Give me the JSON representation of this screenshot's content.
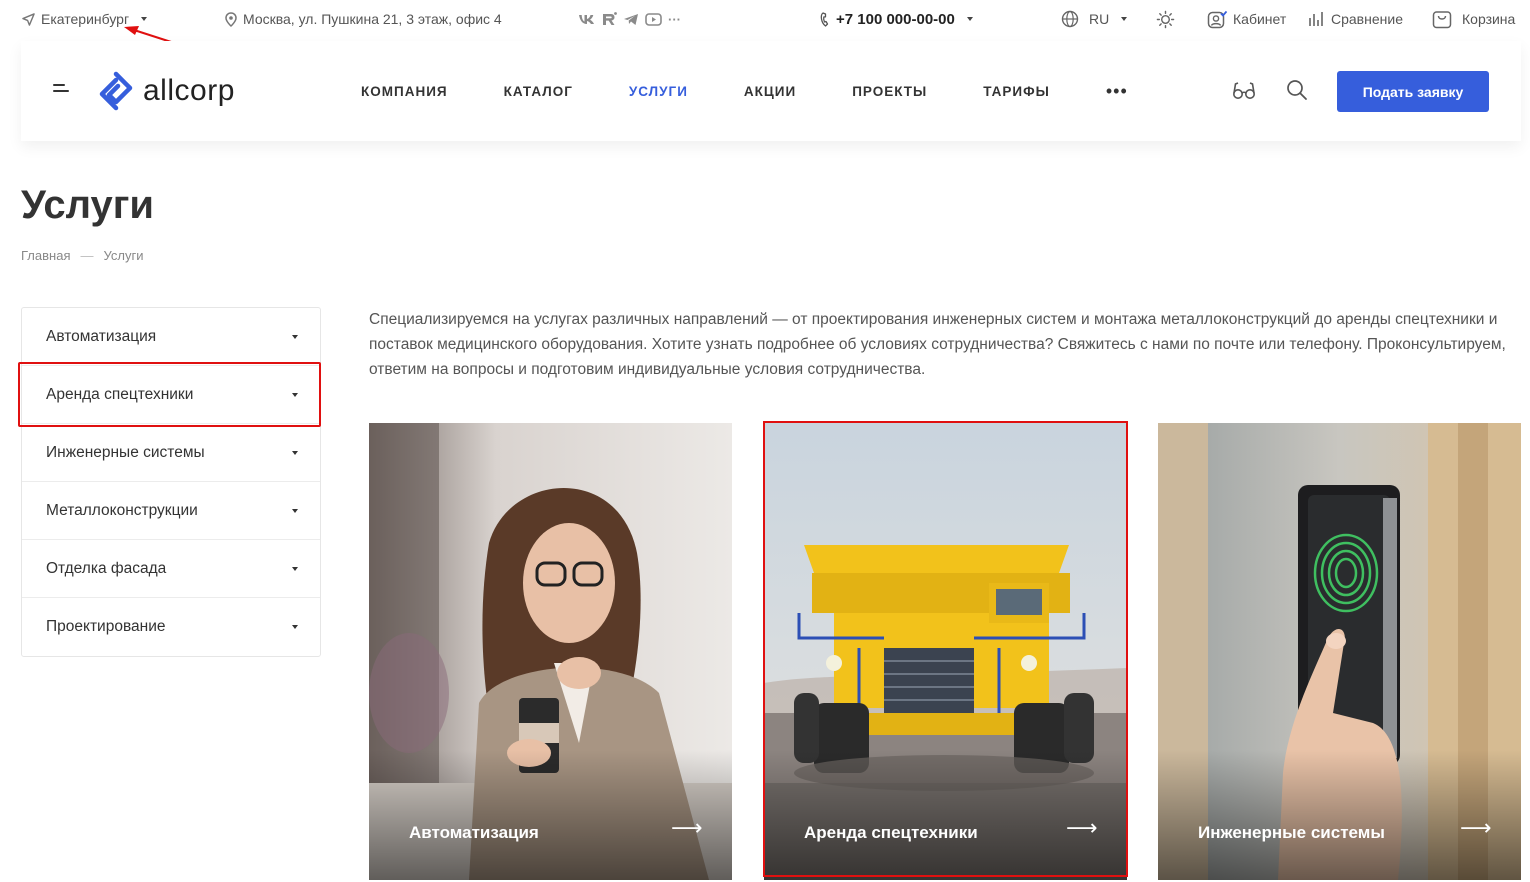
{
  "topbar": {
    "city": "Екатеринбург",
    "address": "Москва, ул. Пушкина 21, 3 этаж, офис 4",
    "socials": [
      "vk-icon",
      "rutube-icon",
      "telegram-icon",
      "youtube-icon",
      "more-icon"
    ],
    "phone": "+7 100 000-00-00",
    "language": "RU",
    "cabinet": "Кабинет",
    "compare": "Сравнение",
    "cart": "Корзина"
  },
  "header": {
    "logo": "allcorp",
    "nav": [
      "КОМПАНИЯ",
      "КАТАЛОГ",
      "УСЛУГИ",
      "АКЦИИ",
      "ПРОЕКТЫ",
      "ТАРИФЫ"
    ],
    "nav_more": "•••",
    "active_nav": "УСЛУГИ",
    "cta": "Подать заявку"
  },
  "page": {
    "title": "Услуги",
    "breadcrumbs": [
      "Главная",
      "Услуги"
    ],
    "breadcrumb_separator": "—",
    "intro": "Специализируемся на услугах различных направлений — от проектирования инженерных систем и монтажа металлоконструкций до аренды спецтехники и поставок медицинского оборудования. Хотите узнать подробнее об условиях сотрудничества? Свяжитесь с нами по почте или телефону. Проконсультируем, ответим на вопросы и подготовим индивидуальные условия сотрудничества."
  },
  "sidebar": {
    "items": [
      "Автоматизация",
      "Аренда спецтехники",
      "Инженерные системы",
      "Металлоконструкции",
      "Отделка фасада",
      "Проектирование"
    ]
  },
  "cards": [
    {
      "title": "Автоматизация",
      "arrow": "⟶"
    },
    {
      "title": "Аренда спецтехники",
      "arrow": "⟶"
    },
    {
      "title": "Инженерные системы",
      "arrow": "⟶"
    }
  ],
  "colors": {
    "accent": "#365edc",
    "annotation": "#e01010",
    "truck": "#f2c21b"
  }
}
